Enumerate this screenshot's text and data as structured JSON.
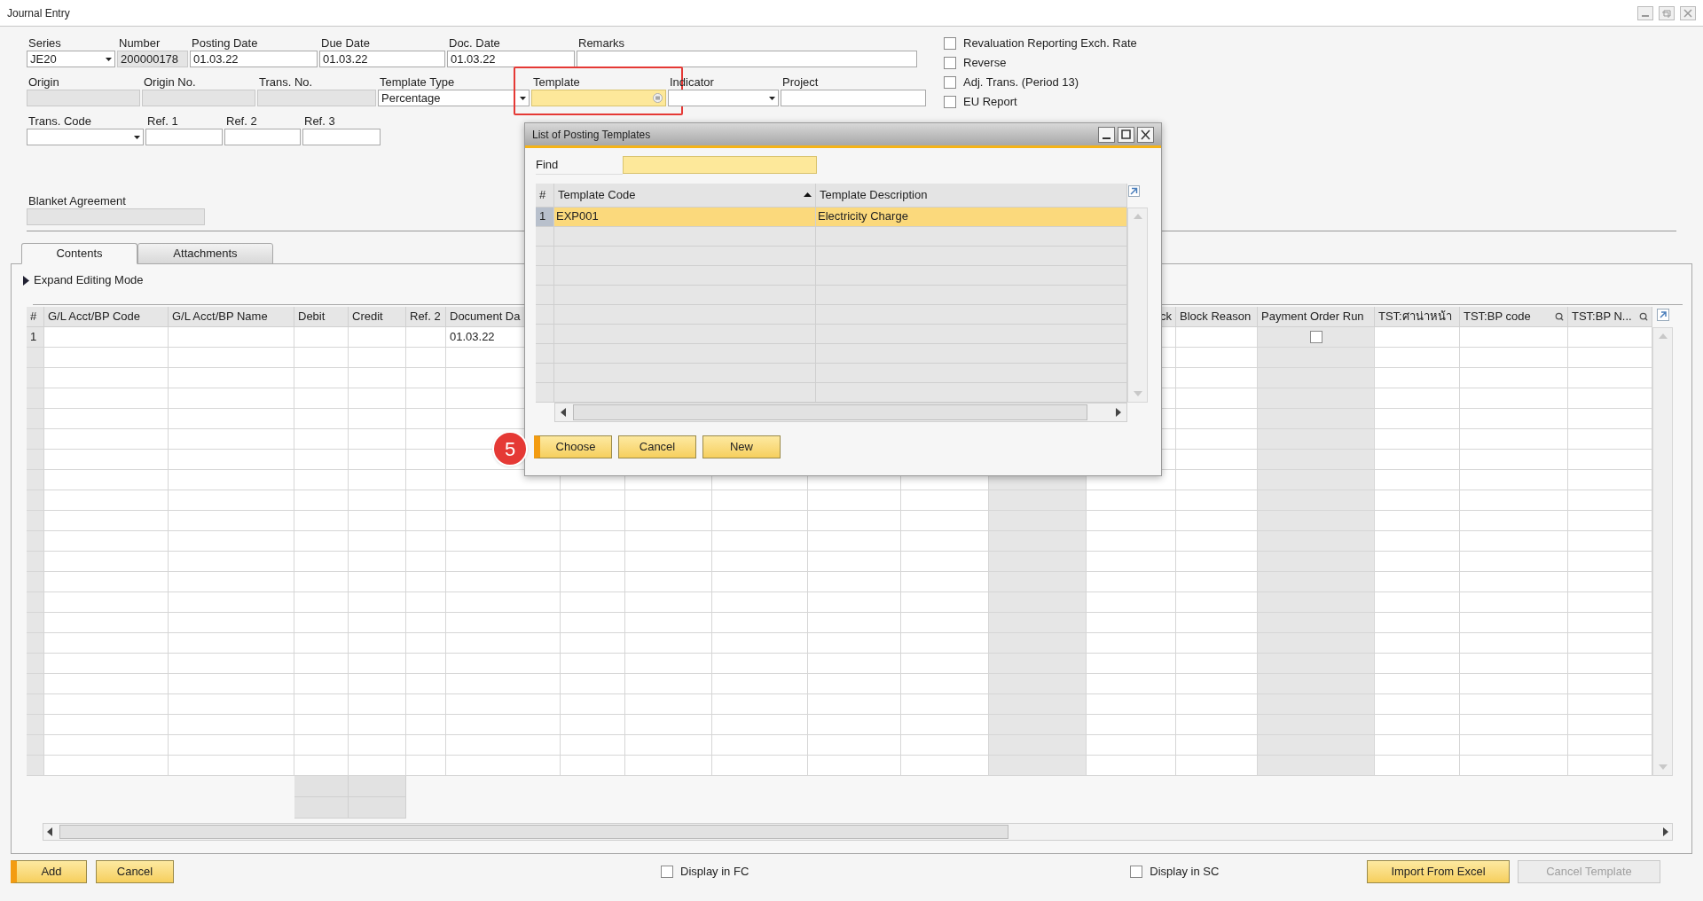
{
  "window": {
    "title": "Journal Entry"
  },
  "field_rows": [
    [
      {
        "label": "Series",
        "value": "JE20",
        "kind": "dropdown"
      },
      {
        "label": "Number",
        "value": "200000178",
        "kind": "readonly"
      },
      {
        "label": "Posting Date",
        "value": "01.03.22",
        "kind": "text"
      },
      {
        "label": "Due Date",
        "value": "01.03.22",
        "kind": "text"
      },
      {
        "label": "Doc. Date",
        "value": "01.03.22",
        "kind": "text"
      },
      {
        "label": "Remarks",
        "kind": "text"
      }
    ],
    [
      {
        "label": "Origin",
        "kind": "readonly"
      },
      {
        "label": "Origin No.",
        "kind": "readonly"
      },
      {
        "label": "Trans. No.",
        "kind": "readonly"
      },
      {
        "label": "Template Type",
        "value": "Percentage",
        "kind": "dropdown"
      },
      {
        "label": "Template",
        "kind": "lookup",
        "highlighted": true
      },
      {
        "label": "Indicator",
        "kind": "dropdown"
      },
      {
        "label": "Project",
        "kind": "text"
      }
    ],
    [
      {
        "label": "Trans. Code",
        "kind": "dropdown"
      },
      {
        "label": "Ref. 1",
        "kind": "text"
      },
      {
        "label": "Ref. 2",
        "kind": "text"
      },
      {
        "label": "Ref. 3",
        "kind": "text"
      }
    ],
    [
      {
        "label": "Blanket Agreement",
        "kind": "readonly"
      }
    ]
  ],
  "options": [
    {
      "label": "Revaluation Reporting Exch. Rate",
      "checked": false
    },
    {
      "label": "Reverse",
      "checked": false
    },
    {
      "label": "Adj. Trans. (Period 13)",
      "checked": false
    },
    {
      "label": "EU Report",
      "checked": false
    }
  ],
  "tabs": [
    {
      "label": "Contents",
      "selected": true
    },
    {
      "label": "Attachments",
      "selected": false
    }
  ],
  "expand_toggle": {
    "label": "Expand Editing Mode",
    "expanded": false
  },
  "table": {
    "columns": [
      {
        "label": "#"
      },
      {
        "label": "G/L Acct/BP Code"
      },
      {
        "label": "G/L Acct/BP Name"
      },
      {
        "label": "Debit"
      },
      {
        "label": "Credit"
      },
      {
        "label": "Ref. 2"
      },
      {
        "label": "Document Da"
      },
      {
        "label": "ck"
      },
      {
        "label": "Block Reason"
      },
      {
        "label": "Payment Order Run"
      },
      {
        "label": "TST:ศาน่าหน้า"
      },
      {
        "label": "TST:BP code",
        "searchable": true
      },
      {
        "label": "TST:BP N...",
        "searchable": true
      }
    ],
    "rows": [
      {
        "number": "1",
        "document_date": "01.03.22",
        "payment_order_run": false
      }
    ]
  },
  "dialog": {
    "title": "List of Posting Templates",
    "find_label": "Find",
    "columns": [
      "#",
      "Template Code",
      "Template Description"
    ],
    "rows": [
      {
        "number": "1",
        "code": "EXP001",
        "description": "Electricity Charge",
        "selected": true
      }
    ],
    "buttons": [
      {
        "label": "Choose",
        "primary": true
      },
      {
        "label": "Cancel",
        "primary": false
      },
      {
        "label": "New",
        "primary": false
      }
    ]
  },
  "step_badge": "5",
  "footer": {
    "left_buttons": [
      {
        "label": "Add",
        "primary": true
      },
      {
        "label": "Cancel",
        "primary": false
      }
    ],
    "display_options": [
      {
        "label": "Display in FC",
        "checked": false
      },
      {
        "label": "Display in SC",
        "checked": false
      }
    ],
    "right_buttons": [
      {
        "label": "Import From Excel",
        "disabled": false
      },
      {
        "label": "Cancel Template",
        "disabled": true
      }
    ]
  }
}
